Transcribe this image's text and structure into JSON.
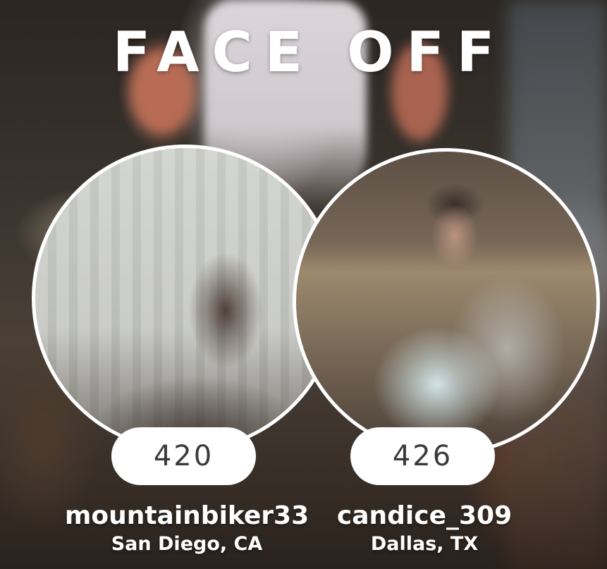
{
  "title": "FACE OFF",
  "players": [
    {
      "score": "420",
      "username": "mountainbiker33",
      "location": "San Diego, CA"
    },
    {
      "score": "426",
      "username": "candice_309",
      "location": "Dallas, TX"
    }
  ]
}
